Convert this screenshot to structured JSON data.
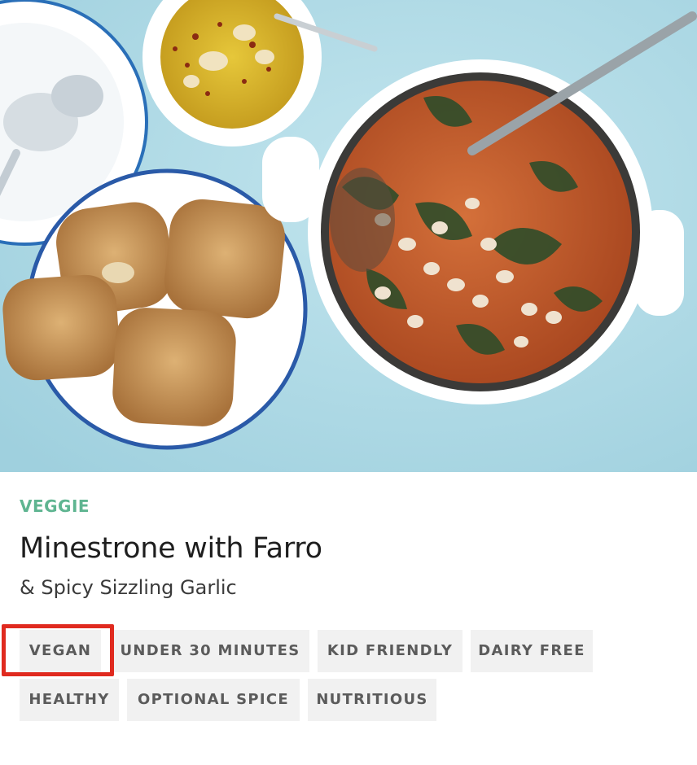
{
  "recipe": {
    "category": "VEGGIE",
    "title": "Minestrone with Farro",
    "subtitle": "& Spicy Sizzling Garlic",
    "tags": [
      "VEGAN",
      "UNDER 30 MINUTES",
      "KID FRIENDLY",
      "DAIRY FREE",
      "HEALTHY",
      "OPTIONAL SPICE",
      "NUTRITIOUS"
    ],
    "highlighted_tag": "VEGAN"
  },
  "colors": {
    "category": "#5fb591",
    "highlight_border": "#e02a1f",
    "tag_background": "#f1f1f1"
  }
}
